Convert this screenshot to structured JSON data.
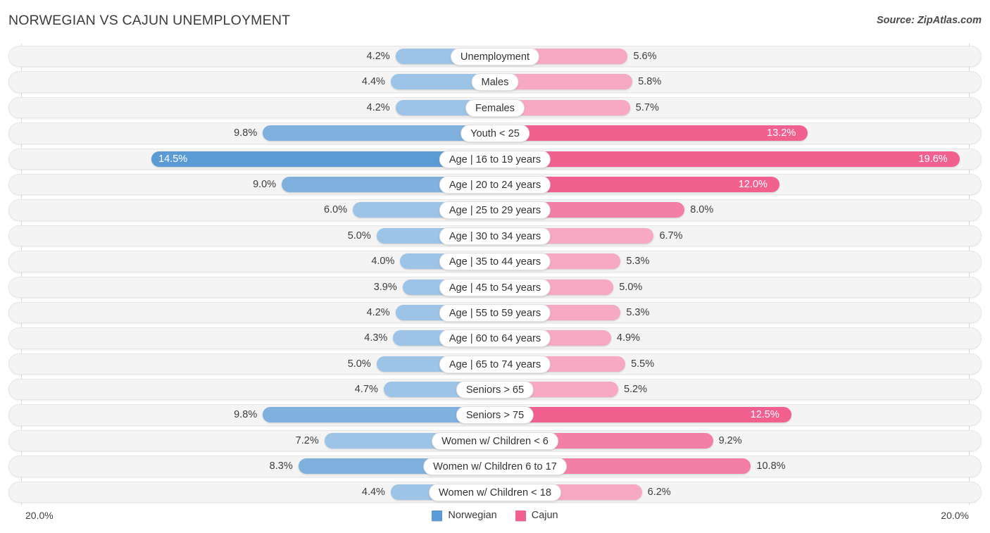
{
  "header": {
    "title": "NORWEGIAN VS CAJUN UNEMPLOYMENT",
    "source": "Source: ZipAtlas.com"
  },
  "axis": {
    "left_label": "20.0%",
    "right_label": "20.0%",
    "max": 20.0
  },
  "legend": {
    "items": [
      {
        "label": "Norwegian",
        "color": "#5b9bd5"
      },
      {
        "label": "Cajun",
        "color": "#f2608f"
      }
    ]
  },
  "colors": {
    "left_light": "#9dc3e6",
    "left_mid": "#7fb0de",
    "left_dark": "#5b9bd5",
    "right_light": "#f7a8c3",
    "right_mid": "#f47fa6",
    "right_dark": "#f2608f",
    "track": "#f4f4f4",
    "gridline": "#d8d8d8"
  },
  "chart_data": {
    "type": "bar",
    "title": "NORWEGIAN VS CAJUN UNEMPLOYMENT",
    "subtitle": "",
    "xlabel": "",
    "ylabel": "",
    "orientation": "horizontal-diverging",
    "grid": true,
    "legend_position": "bottom-center",
    "xlim": [
      -20.0,
      20.0
    ],
    "axis_tick_labels": [
      "20.0%",
      "20.0%"
    ],
    "categories": [
      "Unemployment",
      "Males",
      "Females",
      "Youth < 25",
      "Age | 16 to 19 years",
      "Age | 20 to 24 years",
      "Age | 25 to 29 years",
      "Age | 30 to 34 years",
      "Age | 35 to 44 years",
      "Age | 45 to 54 years",
      "Age | 55 to 59 years",
      "Age | 60 to 64 years",
      "Age | 65 to 74 years",
      "Seniors > 65",
      "Seniors > 75",
      "Women w/ Children < 6",
      "Women w/ Children 6 to 17",
      "Women w/ Children < 18"
    ],
    "series": [
      {
        "name": "Norwegian",
        "color": "#5b9bd5",
        "values": [
          4.2,
          4.4,
          4.2,
          9.8,
          14.5,
          9.0,
          6.0,
          5.0,
          4.0,
          3.9,
          4.2,
          4.3,
          5.0,
          4.7,
          9.8,
          7.2,
          8.3,
          4.4
        ],
        "labels": [
          "4.2%",
          "4.4%",
          "4.2%",
          "9.8%",
          "14.5%",
          "9.0%",
          "6.0%",
          "5.0%",
          "4.0%",
          "3.9%",
          "4.2%",
          "4.3%",
          "5.0%",
          "4.7%",
          "9.8%",
          "7.2%",
          "8.3%",
          "4.4%"
        ]
      },
      {
        "name": "Cajun",
        "color": "#f2608f",
        "values": [
          5.6,
          5.8,
          5.7,
          13.2,
          19.6,
          12.0,
          8.0,
          6.7,
          5.3,
          5.0,
          5.3,
          4.9,
          5.5,
          5.2,
          12.5,
          9.2,
          10.8,
          6.2
        ],
        "labels": [
          "5.6%",
          "5.8%",
          "5.7%",
          "13.2%",
          "19.6%",
          "12.0%",
          "8.0%",
          "6.7%",
          "5.3%",
          "5.0%",
          "5.3%",
          "4.9%",
          "5.5%",
          "5.2%",
          "12.5%",
          "9.2%",
          "10.8%",
          "6.2%"
        ]
      }
    ]
  }
}
